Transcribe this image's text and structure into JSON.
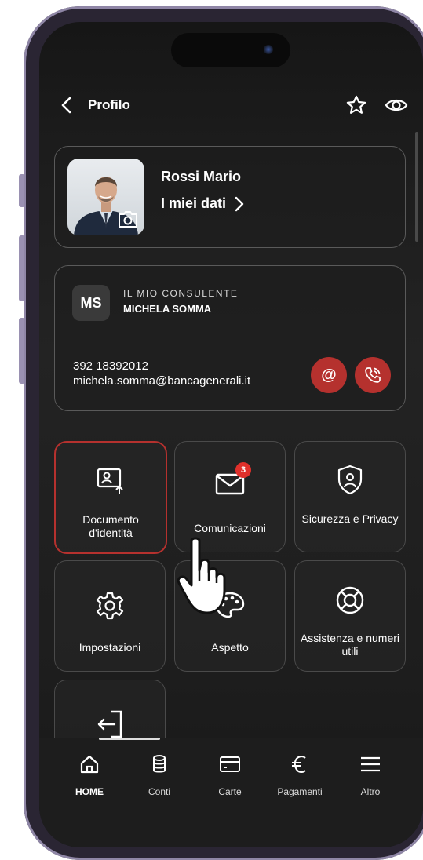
{
  "header": {
    "title": "Profilo"
  },
  "profile": {
    "name": "Rossi Mario",
    "my_data": "I miei dati"
  },
  "consultant": {
    "initials": "MS",
    "label": "IL MIO CONSULENTE",
    "name": "MICHELA SOMMA",
    "phone": "392 18392012",
    "email": "michela.somma@bancagenerali.it",
    "email_button": "@"
  },
  "tiles": [
    {
      "label": "Documento d'identità"
    },
    {
      "label": "Comunicazioni",
      "badge": "3"
    },
    {
      "label": "Sicurezza e Privacy"
    },
    {
      "label": "Impostazioni"
    },
    {
      "label": "Aspetto"
    },
    {
      "label": "Assistenza e numeri utili"
    }
  ],
  "nav": [
    {
      "label": "HOME",
      "icon": "home-icon",
      "active": true
    },
    {
      "label": "Conti",
      "icon": "coins-icon"
    },
    {
      "label": "Carte",
      "icon": "card-icon"
    },
    {
      "label": "Pagamenti",
      "icon": "euro-icon"
    },
    {
      "label": "Altro",
      "icon": "menu-icon"
    }
  ],
  "colors": {
    "accent": "#b5312e",
    "badge": "#e0302b",
    "background": "#1c1c1c"
  }
}
